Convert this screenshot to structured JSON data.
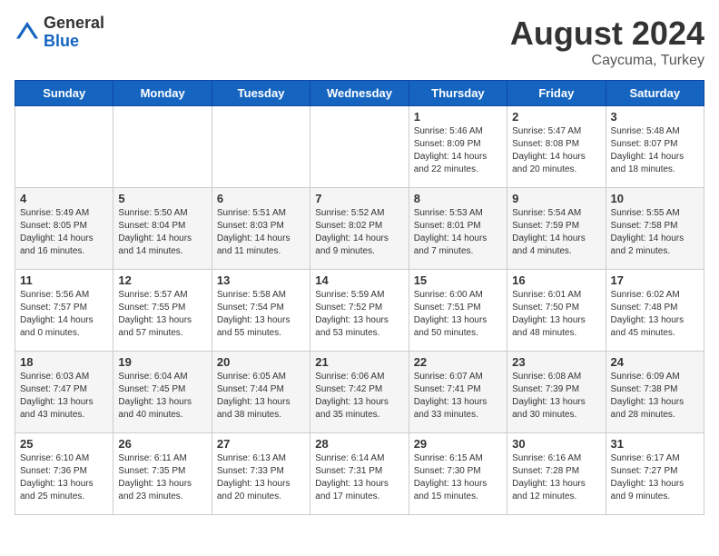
{
  "logo": {
    "general": "General",
    "blue": "Blue"
  },
  "title": {
    "month_year": "August 2024",
    "location": "Caycuma, Turkey"
  },
  "headers": [
    "Sunday",
    "Monday",
    "Tuesday",
    "Wednesday",
    "Thursday",
    "Friday",
    "Saturday"
  ],
  "weeks": [
    [
      {
        "day": "",
        "info": ""
      },
      {
        "day": "",
        "info": ""
      },
      {
        "day": "",
        "info": ""
      },
      {
        "day": "",
        "info": ""
      },
      {
        "day": "1",
        "info": "Sunrise: 5:46 AM\nSunset: 8:09 PM\nDaylight: 14 hours\nand 22 minutes."
      },
      {
        "day": "2",
        "info": "Sunrise: 5:47 AM\nSunset: 8:08 PM\nDaylight: 14 hours\nand 20 minutes."
      },
      {
        "day": "3",
        "info": "Sunrise: 5:48 AM\nSunset: 8:07 PM\nDaylight: 14 hours\nand 18 minutes."
      }
    ],
    [
      {
        "day": "4",
        "info": "Sunrise: 5:49 AM\nSunset: 8:05 PM\nDaylight: 14 hours\nand 16 minutes."
      },
      {
        "day": "5",
        "info": "Sunrise: 5:50 AM\nSunset: 8:04 PM\nDaylight: 14 hours\nand 14 minutes."
      },
      {
        "day": "6",
        "info": "Sunrise: 5:51 AM\nSunset: 8:03 PM\nDaylight: 14 hours\nand 11 minutes."
      },
      {
        "day": "7",
        "info": "Sunrise: 5:52 AM\nSunset: 8:02 PM\nDaylight: 14 hours\nand 9 minutes."
      },
      {
        "day": "8",
        "info": "Sunrise: 5:53 AM\nSunset: 8:01 PM\nDaylight: 14 hours\nand 7 minutes."
      },
      {
        "day": "9",
        "info": "Sunrise: 5:54 AM\nSunset: 7:59 PM\nDaylight: 14 hours\nand 4 minutes."
      },
      {
        "day": "10",
        "info": "Sunrise: 5:55 AM\nSunset: 7:58 PM\nDaylight: 14 hours\nand 2 minutes."
      }
    ],
    [
      {
        "day": "11",
        "info": "Sunrise: 5:56 AM\nSunset: 7:57 PM\nDaylight: 14 hours\nand 0 minutes."
      },
      {
        "day": "12",
        "info": "Sunrise: 5:57 AM\nSunset: 7:55 PM\nDaylight: 13 hours\nand 57 minutes."
      },
      {
        "day": "13",
        "info": "Sunrise: 5:58 AM\nSunset: 7:54 PM\nDaylight: 13 hours\nand 55 minutes."
      },
      {
        "day": "14",
        "info": "Sunrise: 5:59 AM\nSunset: 7:52 PM\nDaylight: 13 hours\nand 53 minutes."
      },
      {
        "day": "15",
        "info": "Sunrise: 6:00 AM\nSunset: 7:51 PM\nDaylight: 13 hours\nand 50 minutes."
      },
      {
        "day": "16",
        "info": "Sunrise: 6:01 AM\nSunset: 7:50 PM\nDaylight: 13 hours\nand 48 minutes."
      },
      {
        "day": "17",
        "info": "Sunrise: 6:02 AM\nSunset: 7:48 PM\nDaylight: 13 hours\nand 45 minutes."
      }
    ],
    [
      {
        "day": "18",
        "info": "Sunrise: 6:03 AM\nSunset: 7:47 PM\nDaylight: 13 hours\nand 43 minutes."
      },
      {
        "day": "19",
        "info": "Sunrise: 6:04 AM\nSunset: 7:45 PM\nDaylight: 13 hours\nand 40 minutes."
      },
      {
        "day": "20",
        "info": "Sunrise: 6:05 AM\nSunset: 7:44 PM\nDaylight: 13 hours\nand 38 minutes."
      },
      {
        "day": "21",
        "info": "Sunrise: 6:06 AM\nSunset: 7:42 PM\nDaylight: 13 hours\nand 35 minutes."
      },
      {
        "day": "22",
        "info": "Sunrise: 6:07 AM\nSunset: 7:41 PM\nDaylight: 13 hours\nand 33 minutes."
      },
      {
        "day": "23",
        "info": "Sunrise: 6:08 AM\nSunset: 7:39 PM\nDaylight: 13 hours\nand 30 minutes."
      },
      {
        "day": "24",
        "info": "Sunrise: 6:09 AM\nSunset: 7:38 PM\nDaylight: 13 hours\nand 28 minutes."
      }
    ],
    [
      {
        "day": "25",
        "info": "Sunrise: 6:10 AM\nSunset: 7:36 PM\nDaylight: 13 hours\nand 25 minutes."
      },
      {
        "day": "26",
        "info": "Sunrise: 6:11 AM\nSunset: 7:35 PM\nDaylight: 13 hours\nand 23 minutes."
      },
      {
        "day": "27",
        "info": "Sunrise: 6:13 AM\nSunset: 7:33 PM\nDaylight: 13 hours\nand 20 minutes."
      },
      {
        "day": "28",
        "info": "Sunrise: 6:14 AM\nSunset: 7:31 PM\nDaylight: 13 hours\nand 17 minutes."
      },
      {
        "day": "29",
        "info": "Sunrise: 6:15 AM\nSunset: 7:30 PM\nDaylight: 13 hours\nand 15 minutes."
      },
      {
        "day": "30",
        "info": "Sunrise: 6:16 AM\nSunset: 7:28 PM\nDaylight: 13 hours\nand 12 minutes."
      },
      {
        "day": "31",
        "info": "Sunrise: 6:17 AM\nSunset: 7:27 PM\nDaylight: 13 hours\nand 9 minutes."
      }
    ]
  ]
}
